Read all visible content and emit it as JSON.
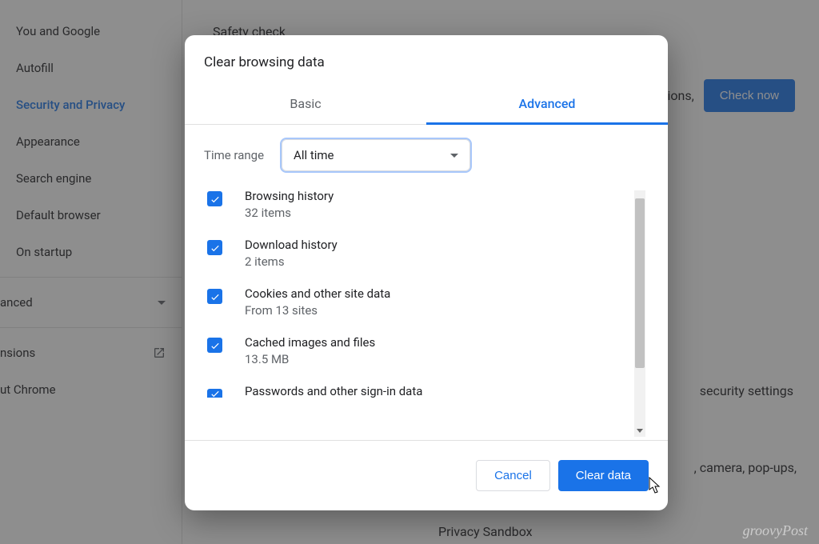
{
  "sidebar": {
    "items": [
      "You and Google",
      "Autofill",
      "Security and Privacy",
      "Appearance",
      "Search engine",
      "Default browser",
      "On startup"
    ],
    "advanced": "anced",
    "extensions": "nsions",
    "about": "ut Chrome"
  },
  "bg": {
    "safety": "Safety check",
    "extensions_text": "tensions,",
    "check_now": "Check now",
    "security_settings": "security settings",
    "camera_popups": ", camera, pop-ups,",
    "privacy_sandbox": "Privacy Sandbox"
  },
  "dialog": {
    "title": "Clear browsing data",
    "tabs": {
      "basic": "Basic",
      "advanced": "Advanced"
    },
    "time_range_label": "Time range",
    "time_range_value": "All time",
    "items": [
      {
        "title": "Browsing history",
        "sub": "32 items"
      },
      {
        "title": "Download history",
        "sub": "2 items"
      },
      {
        "title": "Cookies and other site data",
        "sub": "From 13 sites"
      },
      {
        "title": "Cached images and files",
        "sub": "13.5 MB"
      },
      {
        "title": "Passwords and other sign-in data",
        "sub": ""
      }
    ],
    "cancel": "Cancel",
    "clear": "Clear data"
  },
  "watermark": "groovyPost"
}
